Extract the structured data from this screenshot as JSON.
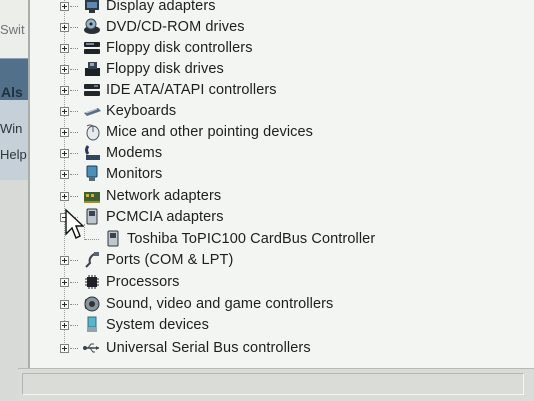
{
  "left": {
    "sw_text": "Swit",
    "als_text": "Als",
    "win_text": "Win",
    "help_text": "Help"
  },
  "tree": {
    "items": [
      {
        "label": "Display adapters",
        "icon": "display-adapter-icon",
        "expanded": false
      },
      {
        "label": "DVD/CD-ROM drives",
        "icon": "cd-drive-icon",
        "expanded": false
      },
      {
        "label": "Floppy disk controllers",
        "icon": "floppy-controller-icon",
        "expanded": false
      },
      {
        "label": "Floppy disk drives",
        "icon": "floppy-drive-icon",
        "expanded": false
      },
      {
        "label": "IDE ATA/ATAPI controllers",
        "icon": "ide-controller-icon",
        "expanded": false
      },
      {
        "label": "Keyboards",
        "icon": "keyboard-icon",
        "expanded": false
      },
      {
        "label": "Mice and other pointing devices",
        "icon": "mouse-icon",
        "expanded": false
      },
      {
        "label": "Modems",
        "icon": "modem-icon",
        "expanded": false
      },
      {
        "label": "Monitors",
        "icon": "monitor-icon",
        "expanded": false
      },
      {
        "label": "Network adapters",
        "icon": "network-adapter-icon",
        "expanded": false
      },
      {
        "label": "PCMCIA adapters",
        "icon": "pcmcia-icon",
        "expanded": true
      },
      {
        "label": "Toshiba ToPIC100 CardBus Controller",
        "icon": "pcmcia-device-icon",
        "child": true
      },
      {
        "label": "Ports (COM & LPT)",
        "icon": "port-icon",
        "expanded": false
      },
      {
        "label": "Processors",
        "icon": "processor-icon",
        "expanded": false
      },
      {
        "label": "Sound, video and game controllers",
        "icon": "sound-icon",
        "expanded": false
      },
      {
        "label": "System devices",
        "icon": "system-device-icon",
        "expanded": false
      },
      {
        "label": "Universal Serial Bus controllers",
        "icon": "usb-icon",
        "expanded": false
      }
    ]
  },
  "colors": {
    "tree_background": "#f3f5f2",
    "left_bar": "#53708a",
    "text": "#1c1f1e"
  }
}
